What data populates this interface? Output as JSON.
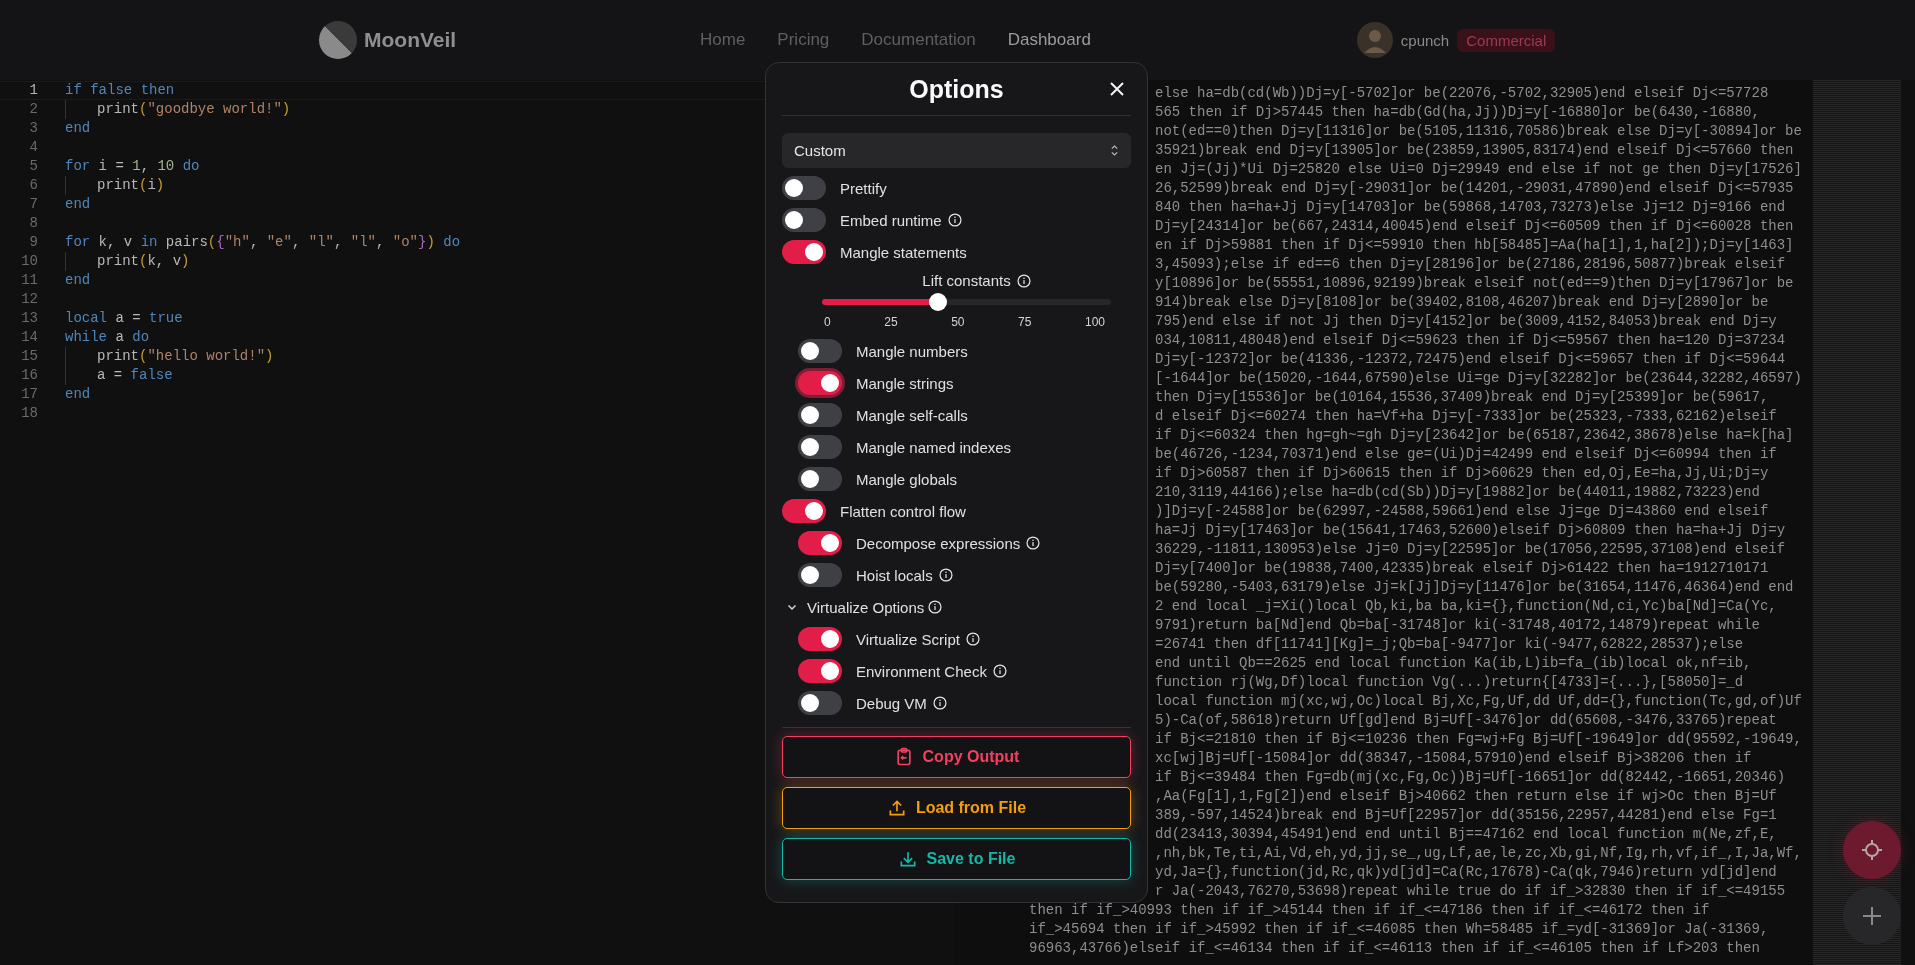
{
  "header": {
    "logo": "MoonVeil",
    "nav": [
      {
        "label": "Home",
        "selected": false
      },
      {
        "label": "Pricing",
        "selected": false
      },
      {
        "label": "Documentation",
        "selected": false
      },
      {
        "label": "Dashboard",
        "selected": true
      }
    ],
    "user": {
      "name": "cpunch",
      "badge": "Commercial"
    }
  },
  "editor": {
    "lines": [
      {
        "number": "1",
        "current": true,
        "indented": false,
        "tokens": [
          {
            "t": "if ",
            "kind": "kw"
          },
          {
            "t": "false ",
            "kind": "kw"
          },
          {
            "t": "then",
            "kind": "kw"
          }
        ]
      },
      {
        "number": "2",
        "current": false,
        "indented": true,
        "tokens": [
          {
            "t": "print",
            "kind": "id"
          },
          {
            "t": "(",
            "kind": "p1"
          },
          {
            "t": "\"goodbye world!\"",
            "kind": "str"
          },
          {
            "t": ")",
            "kind": "p1"
          }
        ]
      },
      {
        "number": "3",
        "current": false,
        "indented": false,
        "tokens": [
          {
            "t": "end",
            "kind": "kw"
          }
        ]
      },
      {
        "number": "4",
        "current": false,
        "indented": false
      },
      {
        "number": "5",
        "current": false,
        "indented": false,
        "tokens": [
          {
            "t": "for ",
            "kind": "kw"
          },
          {
            "t": "i = ",
            "kind": "id"
          },
          {
            "t": "1",
            "kind": "num"
          },
          {
            "t": ", ",
            "kind": "id"
          },
          {
            "t": "10 ",
            "kind": "num"
          },
          {
            "t": "do",
            "kind": "kw"
          }
        ]
      },
      {
        "number": "6",
        "current": false,
        "indented": true,
        "tokens": [
          {
            "t": "print",
            "kind": "id"
          },
          {
            "t": "(",
            "kind": "p1"
          },
          {
            "t": "i",
            "kind": "id"
          },
          {
            "t": ")",
            "kind": "p1"
          }
        ]
      },
      {
        "number": "7",
        "current": false,
        "indented": false,
        "tokens": [
          {
            "t": "end",
            "kind": "kw"
          }
        ]
      },
      {
        "number": "8",
        "current": false,
        "indented": false
      },
      {
        "number": "9",
        "current": false,
        "indented": false,
        "tokens": [
          {
            "t": "for ",
            "kind": "kw"
          },
          {
            "t": "k, v ",
            "kind": "id"
          },
          {
            "t": "in ",
            "kind": "kw"
          },
          {
            "t": "pairs",
            "kind": "id"
          },
          {
            "t": "(",
            "kind": "p1"
          },
          {
            "t": "{",
            "kind": "p2"
          },
          {
            "t": "\"h\"",
            "kind": "str"
          },
          {
            "t": ", ",
            "kind": "id"
          },
          {
            "t": "\"e\"",
            "kind": "str"
          },
          {
            "t": ", ",
            "kind": "id"
          },
          {
            "t": "\"l\"",
            "kind": "str"
          },
          {
            "t": ", ",
            "kind": "id"
          },
          {
            "t": "\"l\"",
            "kind": "str"
          },
          {
            "t": ", ",
            "kind": "id"
          },
          {
            "t": "\"o\"",
            "kind": "str"
          },
          {
            "t": "}",
            "kind": "p2"
          },
          {
            "t": ")",
            "kind": "p1"
          },
          {
            "t": " do",
            "kind": "kw"
          }
        ]
      },
      {
        "number": "10",
        "current": false,
        "indented": true,
        "tokens": [
          {
            "t": "print",
            "kind": "id"
          },
          {
            "t": "(",
            "kind": "p1"
          },
          {
            "t": "k, v",
            "kind": "id"
          },
          {
            "t": ")",
            "kind": "p1"
          }
        ]
      },
      {
        "number": "11",
        "current": false,
        "indented": false,
        "tokens": [
          {
            "t": "end",
            "kind": "kw"
          }
        ]
      },
      {
        "number": "12",
        "current": false,
        "indented": false
      },
      {
        "number": "13",
        "current": false,
        "indented": false,
        "tokens": [
          {
            "t": "local ",
            "kind": "kw"
          },
          {
            "t": "a = ",
            "kind": "id"
          },
          {
            "t": "true",
            "kind": "kw"
          }
        ]
      },
      {
        "number": "14",
        "current": false,
        "indented": false,
        "tokens": [
          {
            "t": "while ",
            "kind": "kw"
          },
          {
            "t": "a ",
            "kind": "id"
          },
          {
            "t": "do",
            "kind": "kw"
          }
        ]
      },
      {
        "number": "15",
        "current": false,
        "indented": true,
        "tokens": [
          {
            "t": "print",
            "kind": "id"
          },
          {
            "t": "(",
            "kind": "p1"
          },
          {
            "t": "\"hello world!\"",
            "kind": "str"
          },
          {
            "t": ")",
            "kind": "p1"
          }
        ]
      },
      {
        "number": "16",
        "current": false,
        "indented": true,
        "tokens": [
          {
            "t": "a = ",
            "kind": "id"
          },
          {
            "t": "false",
            "kind": "kw"
          }
        ]
      },
      {
        "number": "17",
        "current": false,
        "indented": false,
        "tokens": [
          {
            "t": "end",
            "kind": "kw"
          }
        ]
      },
      {
        "number": "18",
        "current": false,
        "indented": false
      }
    ]
  },
  "output": {
    "lines_beside_dialog": [
      "else ha=db(cd(Wb))Dj=y[-5702]or be(22076,-5702,32905)end elseif Dj<=57728",
      "565 then if Dj>57445 then ha=db(Gd(ha,Jj))Dj=y[-16880]or be(6430,-16880,",
      "not(ed==0)then Dj=y[11316]or be(5105,11316,70586)break else Dj=y[-30894]or be",
      "35921)break end Dj=y[13905]or be(23859,13905,83174)end elseif Dj<=57660 then",
      "en Jj=(Jj)*Ui Dj=25820 else Ui=0 Dj=29949 end else if not ge then Dj=y[17526]",
      "26,52599)break end Dj=y[-29031]or be(14201,-29031,47890)end elseif Dj<=57935",
      "840 then ha=ha+Jj Dj=y[14703]or be(59868,14703,73273)else Jj=12 Dj=9166 end",
      "Dj=y[24314]or be(667,24314,40045)end elseif Dj<=60509 then if Dj<=60028 then",
      "en if Dj>59881 then if Dj<=59910 then hb[58485]=Aa(ha[1],1,ha[2]);Dj=y[1463]",
      "3,45093);else if ed==6 then Dj=y[28196]or be(27186,28196,50877)break elseif",
      "y[10896]or be(55551,10896,92199)break elseif not(ed==9)then Dj=y[17967]or be",
      "914)break else Dj=y[8108]or be(39402,8108,46207)break end Dj=y[2890]or be",
      "795)end else if not Jj then Dj=y[4152]or be(3009,4152,84053)break end Dj=y",
      "034,10811,48048)end elseif Dj<=59623 then if Dj<=59567 then ha=120 Dj=37234",
      "Dj=y[-12372]or be(41336,-12372,72475)end elseif Dj<=59657 then if Dj<=59644",
      "[-1644]or be(15020,-1644,67590)else Ui=ge Dj=y[32282]or be(23644,32282,46597)",
      "then Dj=y[15536]or be(10164,15536,37409)break end Dj=y[25399]or be(59617,",
      "d elseif Dj<=60274 then ha=Vf+ha Dj=y[-7333]or be(25323,-7333,62162)elseif",
      "if Dj<=60324 then hg=gh~=gh Dj=y[23642]or be(65187,23642,38678)else ha=k[ha]",
      "be(46726,-1234,70371)end else ge=(Ui)Dj=42499 end elseif Dj<=60994 then if",
      "if Dj>60587 then if Dj>60615 then if Dj>60629 then ed,Oj,Ee=ha,Jj,Ui;Dj=y",
      "210,3119,44166);else ha=db(cd(Sb))Dj=y[19882]or be(44011,19882,73223)end",
      ")]Dj=y[-24588]or be(62997,-24588,59661)end else Jj=ge Dj=43860 end elseif",
      "ha=Jj Dj=y[17463]or be(15641,17463,52600)elseif Dj>60809 then ha=ha+Jj Dj=y",
      "36229,-11811,130953)else Jj=0 Dj=y[22595]or be(17056,22595,37108)end elseif",
      "Dj=y[7400]or be(19838,7400,42335)break elseif Dj>61422 then ha=1912710171",
      "be(59280,-5403,63179)else Jj=k[Jj]Dj=y[11476]or be(31654,11476,46364)end end",
      "2 end local _j=Xi()local Qb,ki,ba ba,ki={},function(Nd,ci,Yc)ba[Nd]=Ca(Yc,",
      "9791)return ba[Nd]end Qb=ba[-31748]or ki(-31748,40172,14879)repeat while",
      "=26741 then df[11741][Kg]=_j;Qb=ba[-9477]or ki(-9477,62822,28537);else",
      "end until Qb==2625 end local function Ka(ib,L)ib=fa_(ib)local ok,nf=ib,",
      "function rj(Wg,Df)local function Vg(...)return{[4733]={...},[58050]=_d",
      "local function mj(xc,wj,Oc)local Bj,Xc,Fg,Uf,dd Uf,dd={},function(Tc,gd,of)Uf",
      "5)-Ca(of,58618)return Uf[gd]end Bj=Uf[-3476]or dd(65608,-3476,33765)repeat",
      "if Bj<=21810 then if Bj<=10236 then Fg=wj+Fg Bj=Uf[-19649]or dd(95592,-19649,",
      "xc[wj]Bj=Uf[-15084]or dd(38347,-15084,57910)end elseif Bj>38206 then if",
      "if Bj<=39484 then Fg=db(mj(xc,Fg,Oc))Bj=Uf[-16651]or dd(82442,-16651,20346)",
      ",Aa(Fg[1],1,Fg[2])end elseif Bj>40662 then return else if wj>Oc then Bj=Uf",
      "389,-597,14524)break end Bj=Uf[22957]or dd(35156,22957,44281)end else Fg=1",
      "dd(23413,30394,45491)end end until Bj==47162 end local function m(Ne,zf,E,",
      ",nh,bk,Te,ti,Ai,Vd,eh,yd,jj,se_,ug,Lf,ae,le,zc,Xb,gi,Nf,Ig,rh,vf,if_,I,Ja,Wf,",
      "yd,Ja={},function(jd,Rc,qk)yd[jd]=Ca(Rc,17678)-Ca(qk,7946)return yd[jd]end",
      "r Ja(-2043,76270,53698)repeat while true do if if_>32830 then if if_<=49155"
    ],
    "lines_below_dialog": [
      "then if if_>40993 then if if_>45144 then if if_<=47186 then if if_<=46172 then if",
      "if_>45694 then if if_>45992 then if if_<=46085 then Wh=58485 if_=yd[-31369]or Ja(-31369,",
      "96963,43766)elseif if_<=46134 then if if_<=46113 then if if_<=46105 then if Lf>203 then"
    ]
  },
  "dialog": {
    "title": "Options",
    "preset": "Custom",
    "options": [
      {
        "kind": "toggle",
        "label": "Prettify",
        "on": false,
        "info": false,
        "focused": false
      },
      {
        "kind": "toggle",
        "label": "Embed runtime",
        "on": false,
        "info": true,
        "focused": false
      },
      {
        "kind": "toggle",
        "label": "Mangle statements",
        "on": true,
        "info": false,
        "focused": false,
        "children": [
          {
            "kind": "slider",
            "label": "Lift constants",
            "info": true,
            "level": 0.4,
            "ticks": [
              "0",
              "25",
              "50",
              "75",
              "100"
            ]
          },
          {
            "kind": "toggle",
            "label": "Mangle numbers",
            "on": false,
            "info": false,
            "focused": false
          },
          {
            "kind": "toggle",
            "label": "Mangle strings",
            "on": true,
            "info": false,
            "focused": true
          },
          {
            "kind": "toggle",
            "label": "Mangle self-calls",
            "on": false,
            "info": false,
            "focused": false
          },
          {
            "kind": "toggle",
            "label": "Mangle named indexes",
            "on": false,
            "info": false,
            "focused": false
          },
          {
            "kind": "toggle",
            "label": "Mangle globals",
            "on": false,
            "info": false,
            "focused": false
          }
        ]
      },
      {
        "kind": "toggle",
        "label": "Flatten control flow",
        "on": true,
        "info": false,
        "focused": false,
        "children": [
          {
            "kind": "toggle",
            "label": "Decompose expressions",
            "on": true,
            "info": true,
            "focused": false
          },
          {
            "kind": "toggle",
            "label": "Hoist locals",
            "on": false,
            "info": true,
            "focused": false
          }
        ]
      },
      {
        "kind": "section",
        "label": "Virtualize Options",
        "info": true,
        "expanded": true,
        "children": [
          {
            "kind": "toggle",
            "label": "Virtualize Script",
            "on": true,
            "info": true,
            "focused": false
          },
          {
            "kind": "toggle",
            "label": "Environment Check",
            "on": true,
            "info": true,
            "focused": false
          },
          {
            "kind": "toggle",
            "label": "Debug VM",
            "on": false,
            "info": true,
            "focused": false
          }
        ]
      }
    ],
    "buttons": [
      {
        "label": "Copy Output",
        "kind": "copy",
        "color": "#f43f5e"
      },
      {
        "label": "Load from File",
        "kind": "load",
        "color": "#f59e0b"
      },
      {
        "label": "Save to File",
        "kind": "save",
        "color": "#14b8a6"
      }
    ]
  }
}
